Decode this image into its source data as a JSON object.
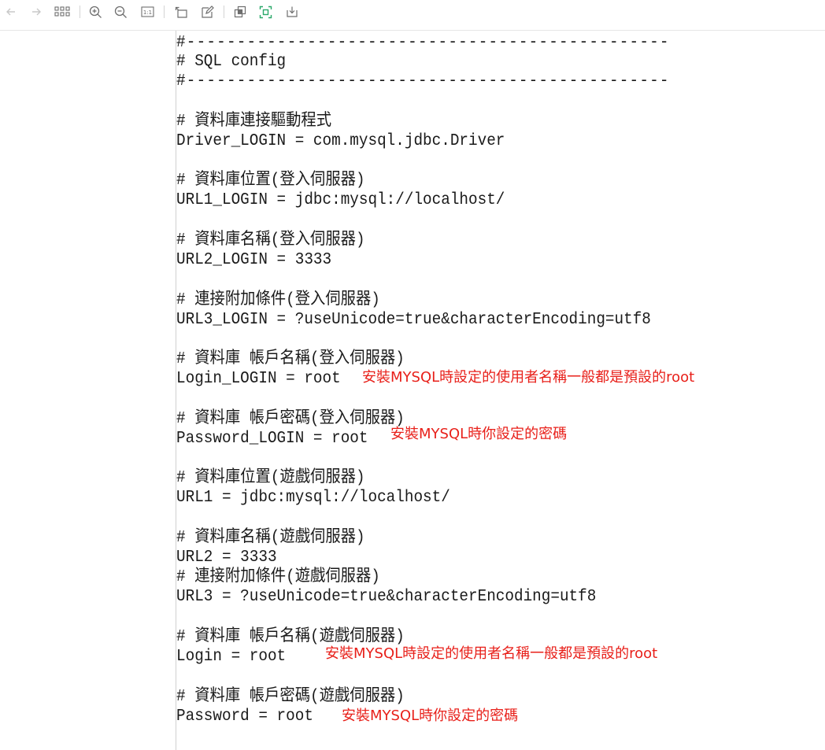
{
  "toolbar": {
    "buttons": [
      {
        "name": "back-button",
        "icon": "arrow-left-icon"
      },
      {
        "name": "forward-button",
        "icon": "arrow-right-icon"
      },
      {
        "name": "thumbnails-button",
        "icon": "grid-icon"
      },
      {
        "name": "zoom-in-button",
        "icon": "zoom-in-icon"
      },
      {
        "name": "zoom-out-button",
        "icon": "zoom-out-icon"
      },
      {
        "name": "actual-size-button",
        "icon": "one-to-one-icon",
        "label": "1:1"
      },
      {
        "name": "rotate-button",
        "icon": "rotate-icon"
      },
      {
        "name": "edit-button",
        "icon": "edit-icon"
      },
      {
        "name": "copy-button",
        "icon": "copy-icon"
      },
      {
        "name": "ocr-button",
        "icon": "scan-icon"
      },
      {
        "name": "save-button",
        "icon": "download-icon"
      }
    ],
    "colors": {
      "icon": "#8c8c8c",
      "disabled_icon": "#c8c8c8",
      "accent": "#2aa86a"
    }
  },
  "code": {
    "lines": [
      "#------------------------------------------------",
      "# SQL config",
      "#------------------------------------------------",
      "# 資料庫連接驅動程式",
      "Driver_LOGIN = com.mysql.jdbc.Driver",
      "# 資料庫位置(登入伺服器)",
      "URL1_LOGIN = jdbc:mysql://localhost/",
      "# 資料庫名稱(登入伺服器)",
      "URL2_LOGIN = 3333",
      "# 連接附加條件(登入伺服器)",
      "URL3_LOGIN = ?useUnicode=true&characterEncoding=utf8",
      "# 資料庫 帳戶名稱(登入伺服器)",
      "Login_LOGIN = root",
      "# 資料庫 帳戶密碼(登入伺服器)",
      "Password_LOGIN = root",
      "# 資料庫位置(遊戲伺服器)",
      "URL1 = jdbc:mysql://localhost/",
      "# 資料庫名稱(遊戲伺服器)",
      "URL2 = 3333",
      "# 連接附加條件(遊戲伺服器)",
      "URL3 = ?useUnicode=true&characterEncoding=utf8",
      "# 資料庫 帳戶名稱(遊戲伺服器)",
      "Login = root",
      "# 資料庫 帳戶密碼(遊戲伺服器)",
      "Password = root"
    ],
    "text_color": "#1a1a1a"
  },
  "annotations": {
    "login_login_note": "安裝MYSQL時設定的使用者名稱一般都是預設的root",
    "password_login_note": "安裝MYSQL時你設定的密碼",
    "login_note": "安裝MYSQL時設定的使用者名稱一般都是預設的root",
    "password_note": "安裝MYSQL時你設定的密碼",
    "color": "#e8201a"
  }
}
